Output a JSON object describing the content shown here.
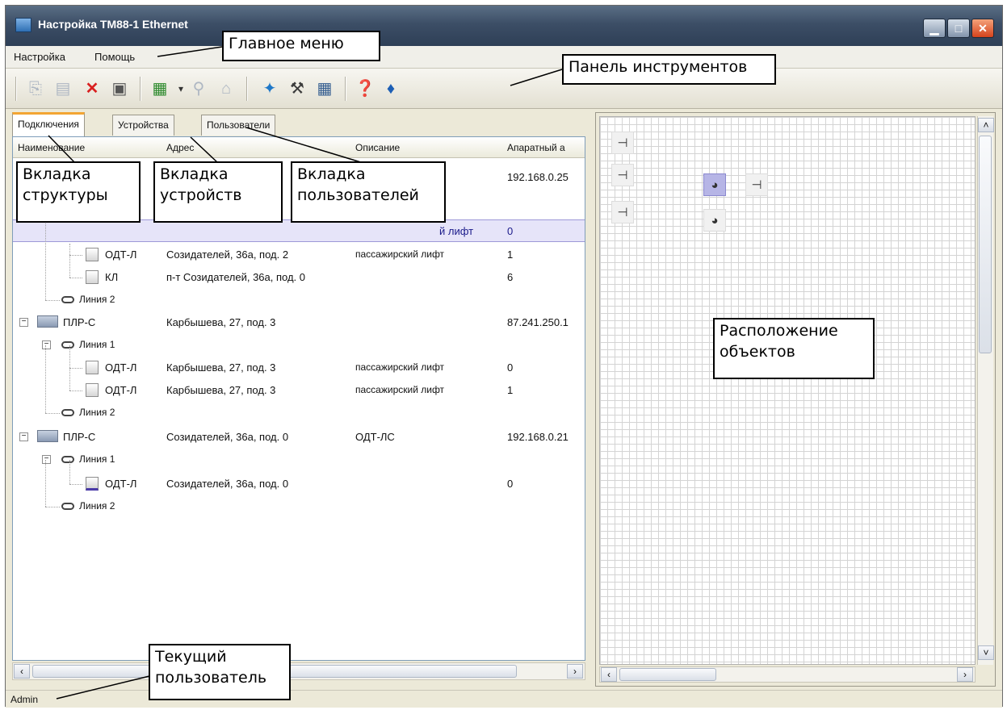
{
  "window": {
    "title": "Настройка ТМ88-1 Ethernet",
    "controls": {
      "minimize": "▁",
      "maximize": "□",
      "close": "✕"
    }
  },
  "menu": {
    "items": [
      "Настройка",
      "Помощь"
    ]
  },
  "toolbar": {
    "icons": [
      "copy-icon",
      "paste-icon",
      "delete-icon",
      "properties-icon",
      "device-icon",
      "dropdown-icon",
      "filter-icon",
      "stamp-icon",
      "connect-icon",
      "tools-icon",
      "table-icon",
      "help-icon",
      "about-icon"
    ]
  },
  "tabs": [
    "Подключения",
    "Устройства",
    "Пользователи"
  ],
  "list": {
    "columns": [
      "Наименование",
      "Адрес",
      "Описание",
      "Апаратный а"
    ],
    "rows": [
      {
        "name": "",
        "address": "",
        "description": "",
        "hw": "192.168.0.25"
      },
      {
        "name": "",
        "address": "",
        "description": "й лифт",
        "hw": "0"
      },
      {
        "name": "ОДТ-Л",
        "address": "Созидателей, 36а, под. 2",
        "description": "пассажирский лифт",
        "hw": "1"
      },
      {
        "name": "КЛ",
        "address": "п-т Созидателей, 36а, под. 0",
        "description": "",
        "hw": "6"
      },
      {
        "name": "Линия 2",
        "address": "",
        "description": "",
        "hw": ""
      },
      {
        "name": "ПЛР-С",
        "address": "Карбышева, 27, под. 3",
        "description": "",
        "hw": "87.241.250.1"
      },
      {
        "name": "Линия 1",
        "address": "",
        "description": "",
        "hw": ""
      },
      {
        "name": "ОДТ-Л",
        "address": "Карбышева, 27, под. 3",
        "description": "пассажирский лифт",
        "hw": "0"
      },
      {
        "name": "ОДТ-Л",
        "address": "Карбышева, 27, под. 3",
        "description": "пассажирский лифт",
        "hw": "1"
      },
      {
        "name": "Линия 2",
        "address": "",
        "description": "",
        "hw": ""
      },
      {
        "name": "ПЛР-С",
        "address": "Созидателей, 36а, под. 0",
        "description": "ОДТ-ЛС",
        "hw": "192.168.0.21"
      },
      {
        "name": "Линия 1",
        "address": "",
        "description": "",
        "hw": ""
      },
      {
        "name": "ОДТ-Л",
        "address": "Созидателей, 36а, под. 0",
        "description": "",
        "hw": "0"
      },
      {
        "name": "Линия 2",
        "address": "",
        "description": "",
        "hw": ""
      }
    ]
  },
  "status": {
    "user": "Admin"
  },
  "callouts": {
    "main_menu": "Главное меню",
    "toolbar": "Панель инструментов",
    "structure_tab": "Вкладка\nструктуры",
    "devices_tab": "Вкладка\nустройств",
    "users_tab": "Вкладка\nпользователей",
    "objects_layout": "Расположение\nобъектов",
    "current_user": "Текущий\nпользователь"
  }
}
